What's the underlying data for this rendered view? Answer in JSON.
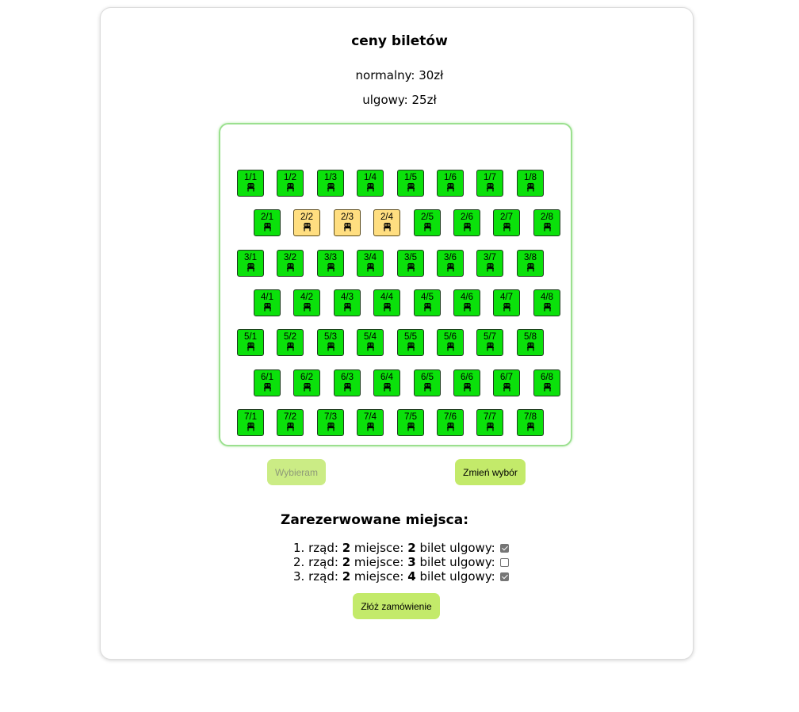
{
  "header": {
    "title": "ceny biletów",
    "price_normal": "normalny: 30zł",
    "price_reduced": "ulgowy: 25zł"
  },
  "colors": {
    "seat_free": "#0be10b",
    "seat_selected": "#ffde80",
    "button": "#c3ea6a",
    "hall_border": "#9be08f"
  },
  "hall": {
    "seat_icon": "chair-icon",
    "rows": [
      {
        "row": 1,
        "seats": [
          "1/1",
          "1/2",
          "1/3",
          "1/4",
          "1/5",
          "1/6",
          "1/7",
          "1/8"
        ],
        "selected": []
      },
      {
        "row": 2,
        "seats": [
          "2/1",
          "2/2",
          "2/3",
          "2/4",
          "2/5",
          "2/6",
          "2/7",
          "2/8"
        ],
        "selected": [
          2,
          3,
          4
        ]
      },
      {
        "row": 3,
        "seats": [
          "3/1",
          "3/2",
          "3/3",
          "3/4",
          "3/5",
          "3/6",
          "3/7",
          "3/8"
        ],
        "selected": []
      },
      {
        "row": 4,
        "seats": [
          "4/1",
          "4/2",
          "4/3",
          "4/4",
          "4/5",
          "4/6",
          "4/7",
          "4/8"
        ],
        "selected": []
      },
      {
        "row": 5,
        "seats": [
          "5/1",
          "5/2",
          "5/3",
          "5/4",
          "5/5",
          "5/6",
          "5/7",
          "5/8"
        ],
        "selected": []
      },
      {
        "row": 6,
        "seats": [
          "6/1",
          "6/2",
          "6/3",
          "6/4",
          "6/5",
          "6/6",
          "6/7",
          "6/8"
        ],
        "selected": []
      },
      {
        "row": 7,
        "seats": [
          "7/1",
          "7/2",
          "7/3",
          "7/4",
          "7/5",
          "7/6",
          "7/7",
          "7/8"
        ],
        "selected": []
      }
    ]
  },
  "actions": {
    "choose_label": "Wybieram",
    "change_label": "Zmień wybór",
    "order_label": "Złóż zamówienie"
  },
  "reservations": {
    "title": "Zarezerwowane miejsca:",
    "row_word": "rząd:",
    "seat_word": "miejsce:",
    "reduced_word": "bilet ulgowy:",
    "items": [
      {
        "index": "1.",
        "row": "2",
        "seat": "2",
        "reduced": true
      },
      {
        "index": "2.",
        "row": "2",
        "seat": "3",
        "reduced": false
      },
      {
        "index": "3.",
        "row": "2",
        "seat": "4",
        "reduced": true
      }
    ]
  }
}
